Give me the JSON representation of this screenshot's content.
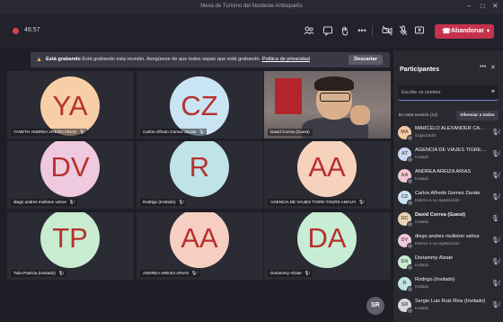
{
  "window": {
    "title": "Mesa de Turismo del Nordeste Antioqueño"
  },
  "call": {
    "timer": "46:57",
    "leave_label": "Abandonar"
  },
  "banner": {
    "title": "Está grabando",
    "message": "Está grabando esta reunión. Asegúrese de que todos sepan que está grabando.",
    "link": "Política de privacidad",
    "dismiss": "Descartar"
  },
  "tiles": [
    {
      "initials": "YA",
      "name": "YANETH ANDREA AREIZA ARIAS",
      "color": "#f7cfa6"
    },
    {
      "initials": "CZ",
      "name": "Carlos Alfredo Gomez Zarate",
      "color": "#c9e4f3"
    },
    {
      "initials": "",
      "name": "David Correa (Guest)",
      "color": ""
    },
    {
      "initials": "DV",
      "name": "diego andres mulleton vahos",
      "color": "#efc9dd"
    },
    {
      "initials": "R",
      "name": "Rodrigo (Invitado)",
      "color": "#bfe3e6"
    },
    {
      "initials": "AA",
      "name": "AGENCIA DE VIAJES TIGRE TOURS AMALFI",
      "color": "#f6d2bd"
    },
    {
      "initials": "TP",
      "name": "Tulia Patricia (Invitado)",
      "color": "#c9ecd1"
    },
    {
      "initials": "AA",
      "name": "ANDREA AREIZA ARIAS",
      "color": "#f6cfc2"
    },
    {
      "initials": "DA",
      "name": "Doriammy Alzate",
      "color": "#c7edd5"
    }
  ],
  "self_avatar": "SR",
  "participants_panel": {
    "title": "Participantes",
    "search_placeholder": "Escribe un nombre",
    "section": "En esta reunión (11)",
    "mute_all": "Silenciar a todos",
    "people": [
      {
        "initials": "MA",
        "name": "MARCELO ALEXANDER CAST...",
        "role": "Organizador",
        "color": "#f1c9a5"
      },
      {
        "initials": "AT",
        "name": "AGENCIA DE VIAJES TIGRE TO...",
        "role": "Invitado",
        "color": "#c9d8f3"
      },
      {
        "initials": "AA",
        "name": "ANDREA AREIZA ARIAS",
        "role": "Invitado",
        "color": "#f2c6d2"
      },
      {
        "initials": "CZ",
        "name": "Carlos Alfredo Gomez Zarate",
        "role": "Externo a su organización",
        "color": "#c9e4f3"
      },
      {
        "initials": "DC",
        "name": "David Correa (Guest)",
        "role": "Invitado",
        "color": "#e7d3b8"
      },
      {
        "initials": "DV",
        "name": "diego andres mulleton vahos",
        "role": "Externo a su organización",
        "color": "#efc9dd"
      },
      {
        "initials": "DA",
        "name": "Doriammy Alzate",
        "role": "Invitado",
        "color": "#c7edd5"
      },
      {
        "initials": "R",
        "name": "Rodrigo (Invitado)",
        "role": "Invitado",
        "color": "#bfe3e6"
      },
      {
        "initials": "SR",
        "name": "Sergio Luis Ruiz Rios (Invitado)",
        "role": "Invitado",
        "color": "#d7d7de"
      }
    ]
  },
  "colors": {
    "accent": "#c4314b",
    "background": "#1e1e26",
    "panel": "#292930",
    "avatar_text": "#b7302e"
  }
}
